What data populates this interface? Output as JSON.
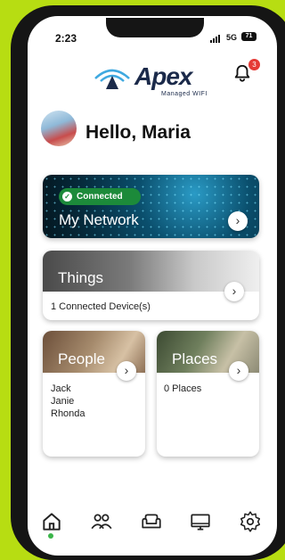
{
  "status_bar": {
    "time": "2:23",
    "network": "5G",
    "battery": "71"
  },
  "header": {
    "logo_text": "Apex",
    "logo_subtitle": "Managed WIFI",
    "notification_count": "3"
  },
  "user": {
    "greeting": "Hello, Maria"
  },
  "network_card": {
    "status": "Connected",
    "title": "My Network"
  },
  "things_card": {
    "title": "Things",
    "subtitle": "1 Connected Device(s)"
  },
  "people_card": {
    "title": "People",
    "members": [
      "Jack",
      "Janie",
      "Rhonda"
    ]
  },
  "places_card": {
    "title": "Places",
    "subtitle": "0 Places"
  },
  "colors": {
    "accent_green": "#3bb54a",
    "brand_navy": "#1b2a4a",
    "badge_red": "#e53935"
  },
  "tabs": [
    {
      "icon": "home-icon",
      "active": true
    },
    {
      "icon": "people-icon",
      "active": false
    },
    {
      "icon": "couch-icon",
      "active": false
    },
    {
      "icon": "monitor-icon",
      "active": false
    },
    {
      "icon": "settings-icon",
      "active": false
    }
  ]
}
